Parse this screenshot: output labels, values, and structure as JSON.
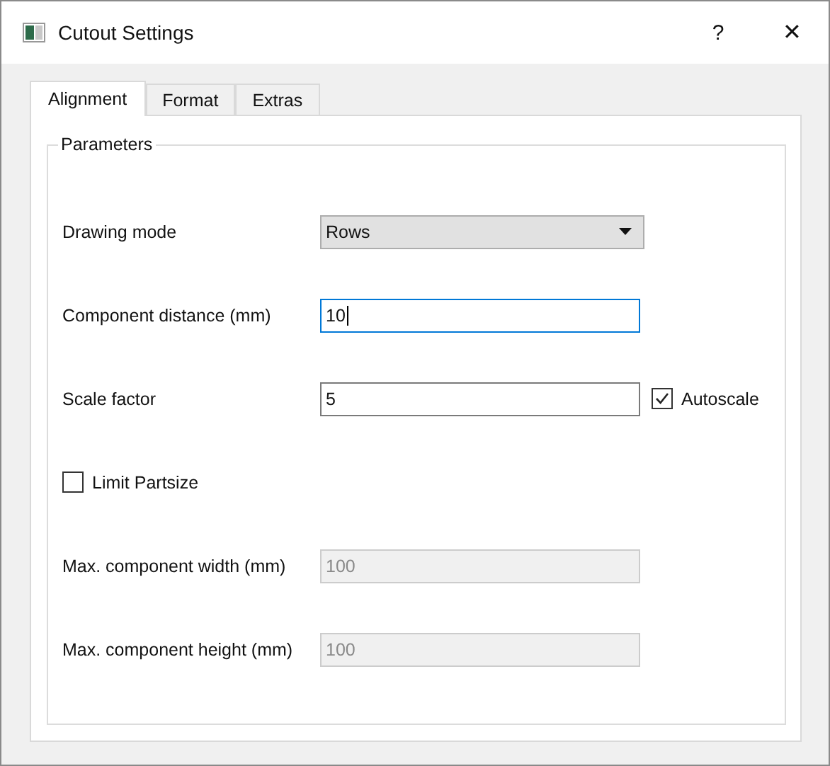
{
  "window": {
    "title": "Cutout Settings",
    "help": "?",
    "close": "✕"
  },
  "tabs": [
    {
      "label": "Alignment",
      "selected": true
    },
    {
      "label": "Format",
      "selected": false
    },
    {
      "label": "Extras",
      "selected": false
    }
  ],
  "group": {
    "title": "Parameters"
  },
  "rows": [
    {
      "kind": "dropdown",
      "label": "Drawing mode",
      "value": "Rows"
    },
    {
      "kind": "text",
      "label": "Component distance (mm)",
      "value": "10",
      "focused": true,
      "disabled": false
    },
    {
      "kind": "text",
      "label": "Scale factor",
      "value": "5",
      "focused": false,
      "disabled": false,
      "checkbox": {
        "label": "Autoscale",
        "checked": true
      }
    },
    {
      "kind": "checkbox",
      "label": "Limit Partsize",
      "checked": false
    },
    {
      "kind": "text",
      "label": "Max. component width (mm)",
      "value": "100",
      "focused": false,
      "disabled": true
    },
    {
      "kind": "text",
      "label": "Max. component height (mm)",
      "value": "100",
      "focused": false,
      "disabled": true
    }
  ]
}
